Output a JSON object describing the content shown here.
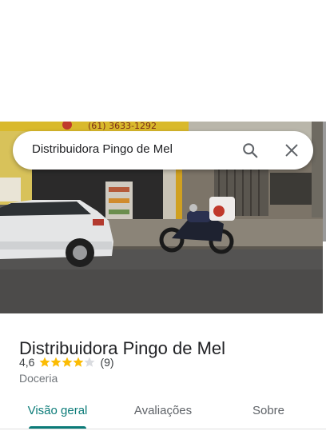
{
  "search": {
    "query": "Distribuidora Pingo de Mel"
  },
  "photo": {
    "sign_text": "(61) 3633-1292"
  },
  "place": {
    "name": "Distribuidora Pingo de Mel",
    "rating": "4,6",
    "rating_value": 4.6,
    "review_count": "(9)",
    "category": "Doceria"
  },
  "tabs": [
    {
      "label": "Visão geral",
      "active": true
    },
    {
      "label": "Avaliações",
      "active": false
    },
    {
      "label": "Sobre",
      "active": false
    }
  ],
  "colors": {
    "accent": "#0b7b78",
    "star": "#fbbc04",
    "text": "#202124",
    "secondary": "#70757a"
  }
}
